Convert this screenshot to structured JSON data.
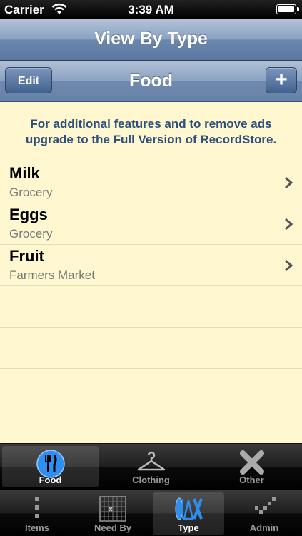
{
  "status": {
    "carrier": "Carrier",
    "time": "3:39 AM"
  },
  "nav": {
    "title": "View By Type"
  },
  "toolbar": {
    "edit_label": "Edit",
    "title": "Food",
    "add_label": "+"
  },
  "promo": "For additional features and to remove ads upgrade to the Full Version of RecordStore.",
  "items": [
    {
      "title": "Milk",
      "subtitle": "Grocery"
    },
    {
      "title": "Eggs",
      "subtitle": "Grocery"
    },
    {
      "title": "Fruit",
      "subtitle": "Farmers Market"
    }
  ],
  "type_tabs": [
    {
      "label": "Food",
      "icon": "fork-knife-icon",
      "selected": true
    },
    {
      "label": "Clothing",
      "icon": "hanger-icon",
      "selected": false
    },
    {
      "label": "Other",
      "icon": "x-icon",
      "selected": false
    }
  ],
  "main_tabs": [
    {
      "label": "Items",
      "icon": "dots-icon",
      "selected": false
    },
    {
      "label": "Need By",
      "icon": "calendar-grid-icon",
      "selected": false
    },
    {
      "label": "Type",
      "icon": "shapes-icon",
      "selected": true
    },
    {
      "label": "Admin",
      "icon": "checkmark-icon",
      "selected": false
    }
  ],
  "colors": {
    "accent": "#2d4f7a",
    "content_bg": "#fff7d0",
    "nav_blue": "#6d88ad",
    "selected_icon": "#2f8ff0"
  }
}
